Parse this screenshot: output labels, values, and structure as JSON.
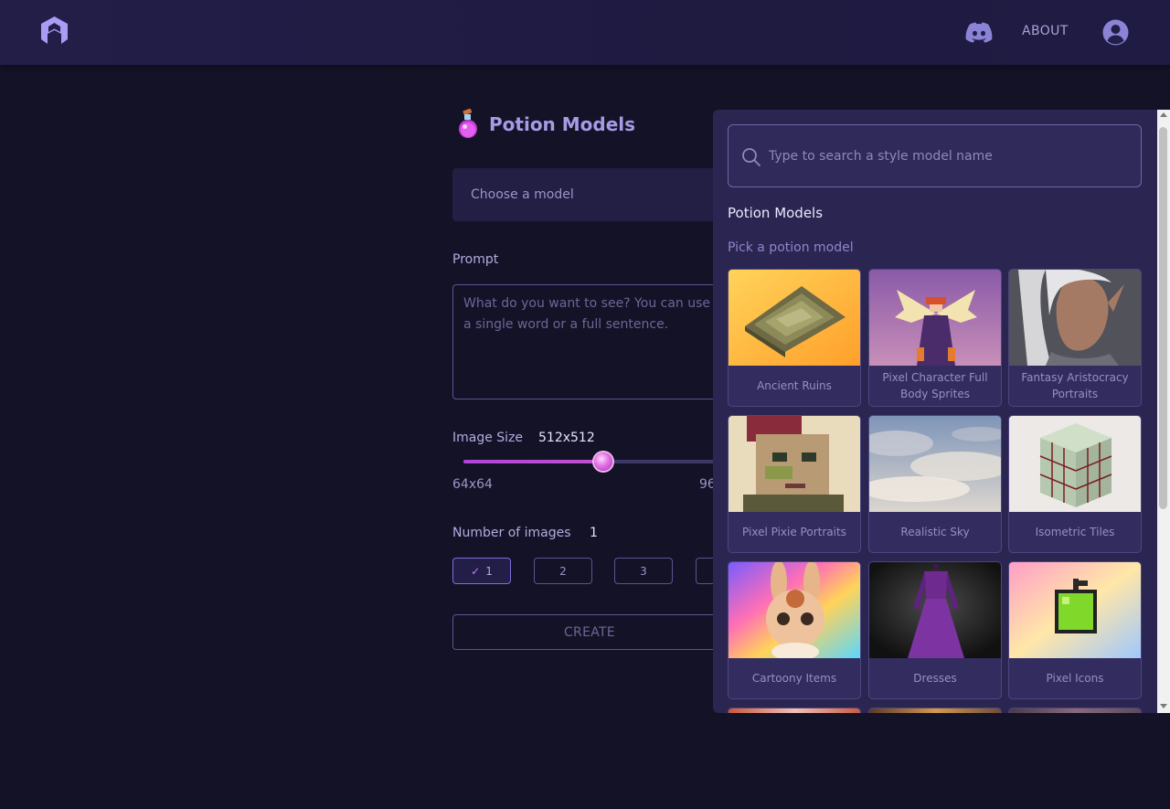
{
  "header": {
    "about_label": "ABOUT",
    "icons": [
      "app-logo-icon",
      "discord-icon",
      "account-icon"
    ]
  },
  "form": {
    "title": "Potion Models",
    "model_select_placeholder": "Choose a model",
    "prompt_label": "Prompt",
    "prompt_placeholder": "What do you want to see? You can use a single word or a full sentence.",
    "image_size_label": "Image Size",
    "image_size_value": "512x512",
    "image_size_min": "64x64",
    "image_size_max_partial": "96",
    "image_size_fraction": 0.53,
    "num_images_label": "Number of images",
    "num_images_value": "1",
    "num_options": [
      "1",
      "2",
      "3",
      ""
    ],
    "create_label": "CREATE"
  },
  "popover": {
    "search_placeholder": "Type to search a style model name",
    "title": "Potion Models",
    "subtitle": "Pick a potion model",
    "models": [
      {
        "label": "Ancient Ruins"
      },
      {
        "label": "Pixel Character Full Body Sprites"
      },
      {
        "label": "Fantasy Aristocracy Portraits"
      },
      {
        "label": "Pixel Pixie Portraits"
      },
      {
        "label": "Realistic Sky"
      },
      {
        "label": "Isometric Tiles"
      },
      {
        "label": "Cartoony Items"
      },
      {
        "label": "Dresses"
      },
      {
        "label": "Pixel Icons"
      }
    ]
  },
  "colors": {
    "background": "#141226",
    "header": "#221e48",
    "accent": "#a59be6",
    "slider": "#b044d8",
    "popover": "#2a2551"
  }
}
